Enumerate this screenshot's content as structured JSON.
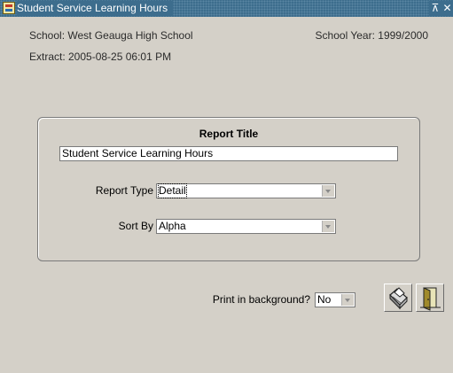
{
  "window": {
    "title": "Student Service Learning Hours",
    "restore_glyph": "⊼",
    "close_glyph": "✕"
  },
  "info": {
    "school": "School: West Geauga High School",
    "school_year": "School Year: 1999/2000",
    "extract": "Extract:  2005-08-25 06:01 PM"
  },
  "report": {
    "title_label": "Report Title",
    "title_value": "Student Service Learning Hours",
    "report_type_label": "Report Type",
    "report_type_value": "Detail",
    "sort_by_label": "Sort By",
    "sort_by_value": "Alpha"
  },
  "footer": {
    "print_bg_label": "Print in background?",
    "print_bg_value": "No"
  },
  "icons": {
    "print": "printer-icon",
    "exit": "exit-door-icon"
  },
  "colors": {
    "titlebar": "#3d6d8d",
    "background": "#d4d0c8"
  }
}
